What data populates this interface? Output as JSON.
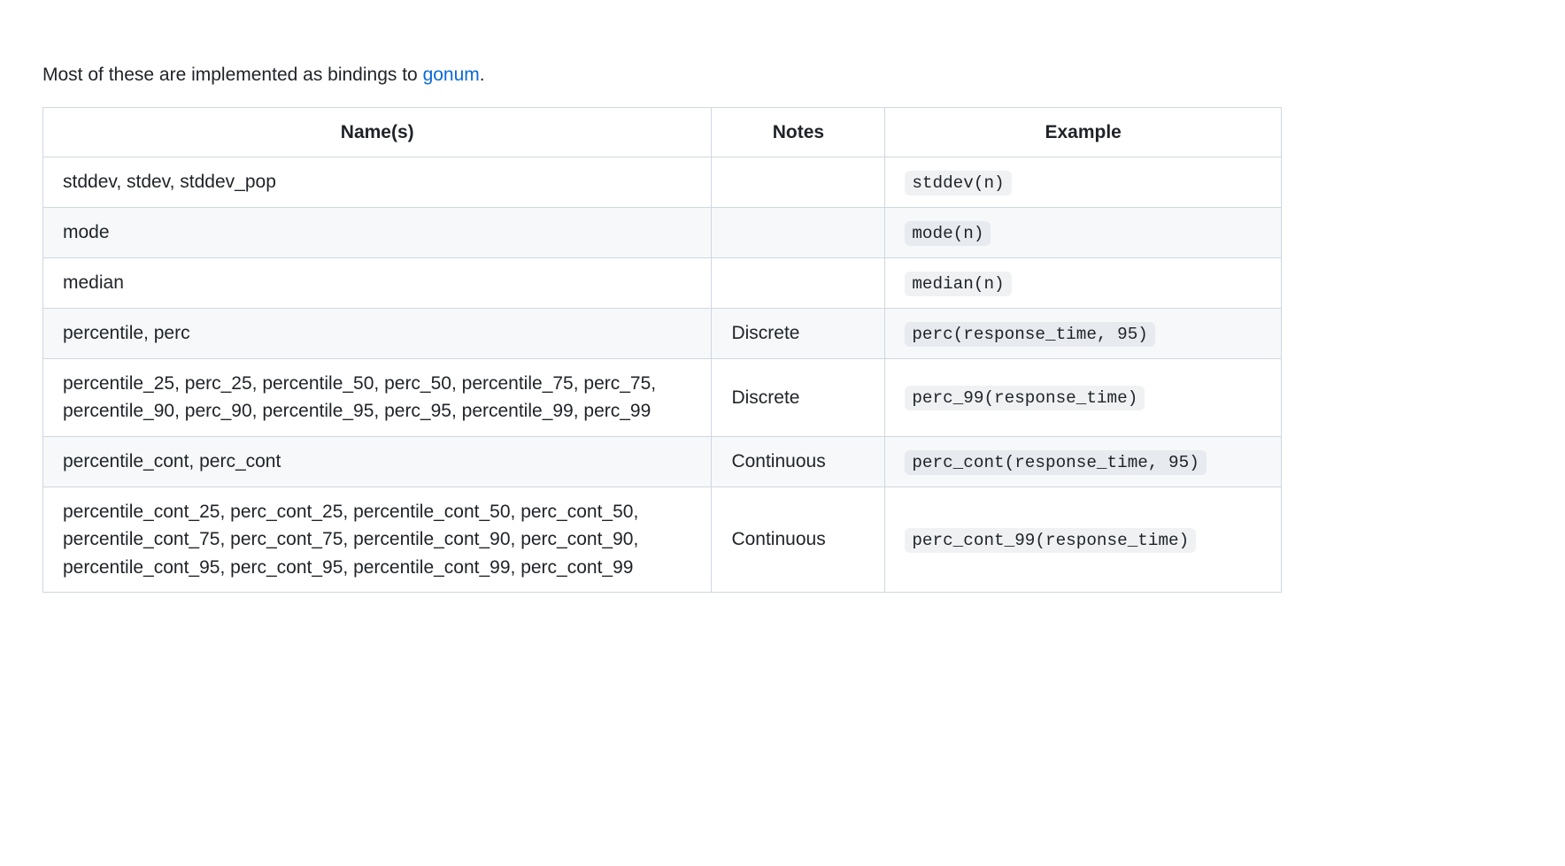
{
  "intro": {
    "prefix": "Most of these are implemented as bindings to ",
    "link_text": "gonum",
    "suffix": "."
  },
  "table": {
    "headers": {
      "names": "Name(s)",
      "notes": "Notes",
      "example": "Example"
    },
    "rows": [
      {
        "names": "stddev, stdev, stddev_pop",
        "notes": "",
        "example": "stddev(n)"
      },
      {
        "names": "mode",
        "notes": "",
        "example": "mode(n)"
      },
      {
        "names": "median",
        "notes": "",
        "example": "median(n)"
      },
      {
        "names": "percentile, perc",
        "notes": "Discrete",
        "example": "perc(response_time, 95)"
      },
      {
        "names": "percentile_25, perc_25, percentile_50, perc_50, percentile_75, perc_75, percentile_90, perc_90, percentile_95, perc_95, percentile_99, perc_99",
        "notes": "Discrete",
        "example": "perc_99(response_time)"
      },
      {
        "names": "percentile_cont, perc_cont",
        "notes": "Continuous",
        "example": "perc_cont(response_time, 95)"
      },
      {
        "names": "percentile_cont_25, perc_cont_25, percentile_cont_50, perc_cont_50, percentile_cont_75, perc_cont_75, percentile_cont_90, perc_cont_90, percentile_cont_95, perc_cont_95, percentile_cont_99, perc_cont_99",
        "notes": "Continuous",
        "example": "perc_cont_99(response_time)"
      }
    ]
  }
}
